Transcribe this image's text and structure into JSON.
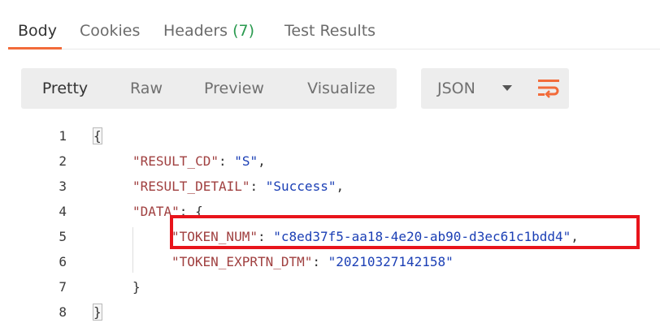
{
  "response_tabs": [
    {
      "label": "Body"
    },
    {
      "label": "Cookies"
    },
    {
      "label": "Headers ",
      "count": "(7)"
    },
    {
      "label": "Test Results"
    }
  ],
  "view_modes": [
    "Pretty",
    "Raw",
    "Preview",
    "Visualize"
  ],
  "format_select": {
    "value": "JSON"
  },
  "code": {
    "line_numbers": [
      "1",
      "2",
      "3",
      "4",
      "5",
      "6",
      "7",
      "8"
    ],
    "open_brace": "{",
    "close_brace": "}",
    "result_cd_key": "\"RESULT_CD\"",
    "result_cd_value": "\"S\"",
    "result_detail_key": "\"RESULT_DETAIL\"",
    "result_detail_value": "\"Success\"",
    "data_key": "\"DATA\"",
    "token_num_key": "\"TOKEN_NUM\"",
    "token_num_value": "\"c8ed37f5-aa18-4e20-ab90-d3ec61c1bdd4\"",
    "token_exp_key": "\"TOKEN_EXPRTN_DTM\"",
    "token_exp_value": "\"20210327142158\"",
    "colon": ": ",
    "comma": ",",
    "data_open": ": {",
    "data_close": "}"
  },
  "colors": {
    "accent": "#f26b3a",
    "count": "#2a9a4f",
    "highlight": "#e8141b"
  },
  "icons": {
    "wrap": "wrap-lines-icon",
    "caret": "chevron-down-icon"
  }
}
